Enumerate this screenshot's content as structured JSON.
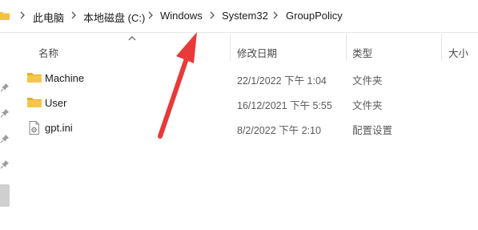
{
  "breadcrumb": {
    "items": [
      "此电脑",
      "本地磁盘 (C:)",
      "Windows",
      "System32",
      "GroupPolicy"
    ]
  },
  "columns": {
    "name": "名称",
    "date": "修改日期",
    "type": "类型",
    "size": "大小"
  },
  "files": [
    {
      "name": "Machine",
      "date": "22/1/2022 下午 1:04",
      "type": "文件夹",
      "icon": "folder-icon"
    },
    {
      "name": "User",
      "date": "16/12/2021 下午 5:55",
      "type": "文件夹",
      "icon": "folder-icon"
    },
    {
      "name": "gpt.ini",
      "date": "8/2/2022 下午 2:10",
      "type": "配置设置",
      "icon": "ini-file-icon"
    }
  ],
  "colors": {
    "folder": "#f4c243",
    "arrow": "#e83a3a",
    "pin": "#9a9a9a"
  }
}
